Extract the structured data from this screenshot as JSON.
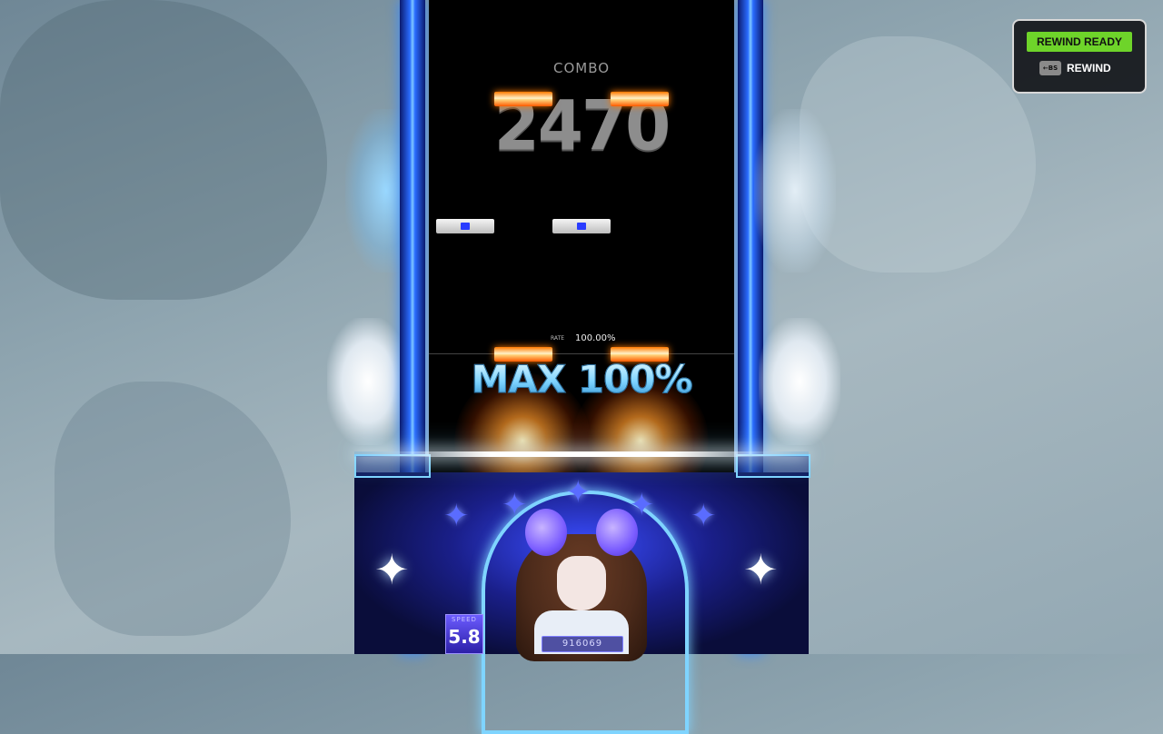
{
  "combo": {
    "label": "COMBO",
    "value": "2470"
  },
  "rate": {
    "label": "RATE",
    "value": "100.00%"
  },
  "judgement": {
    "text": "MAX 100%"
  },
  "speed": {
    "label": "SPEED",
    "value": "5.8"
  },
  "score": {
    "value": "916069"
  },
  "rewind": {
    "status": "REWIND READY",
    "key": "←BS",
    "label": "REWIND",
    "status_color": "#6ed42a"
  },
  "colors": {
    "field": "#000000",
    "accent_blue": "#2a6cff",
    "note_orange": "#ff7a00"
  }
}
